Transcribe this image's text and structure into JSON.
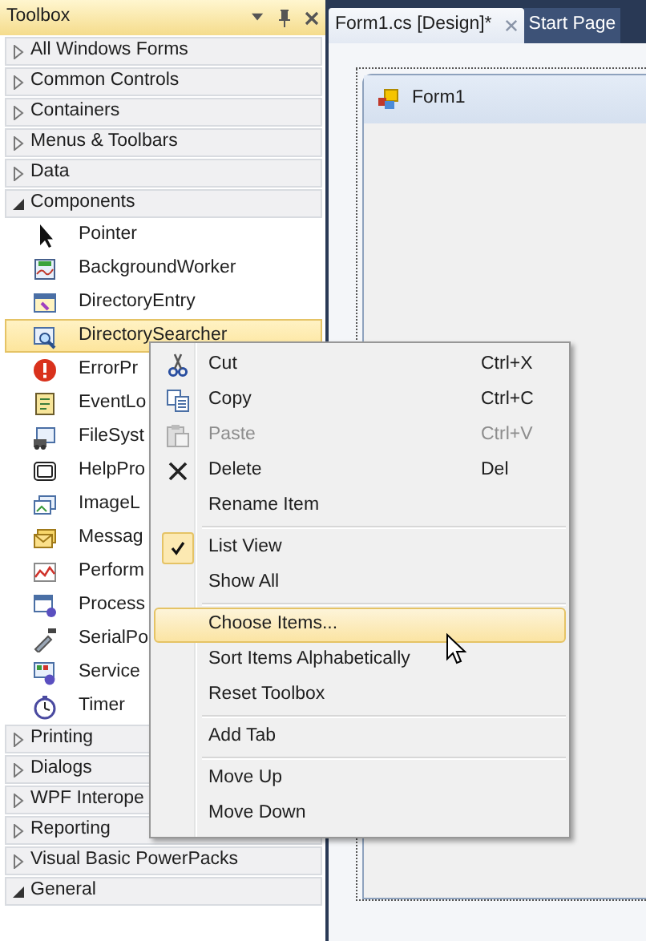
{
  "toolbox": {
    "title": "Toolbox",
    "categories": [
      {
        "label": "All Windows Forms",
        "expanded": false
      },
      {
        "label": "Common Controls",
        "expanded": false
      },
      {
        "label": "Containers",
        "expanded": false
      },
      {
        "label": "Menus & Toolbars",
        "expanded": false
      },
      {
        "label": "Data",
        "expanded": false
      },
      {
        "label": "Components",
        "expanded": true,
        "items": [
          {
            "label": "Pointer",
            "selected": false
          },
          {
            "label": "BackgroundWorker",
            "selected": false
          },
          {
            "label": "DirectoryEntry",
            "selected": false
          },
          {
            "label": "DirectorySearcher",
            "selected": true
          },
          {
            "label": "ErrorPr",
            "selected": false
          },
          {
            "label": "EventLo",
            "selected": false
          },
          {
            "label": "FileSyst",
            "selected": false
          },
          {
            "label": "HelpPro",
            "selected": false
          },
          {
            "label": "ImageL",
            "selected": false
          },
          {
            "label": "Messag",
            "selected": false
          },
          {
            "label": "Perform",
            "selected": false
          },
          {
            "label": "Process",
            "selected": false
          },
          {
            "label": "SerialPo",
            "selected": false
          },
          {
            "label": "Service",
            "selected": false
          },
          {
            "label": "Timer",
            "selected": false
          }
        ]
      },
      {
        "label": "Printing",
        "expanded": false
      },
      {
        "label": "Dialogs",
        "expanded": false
      },
      {
        "label": "WPF Interope",
        "expanded": false
      },
      {
        "label": "Reporting",
        "expanded": false
      },
      {
        "label": "Visual Basic PowerPacks",
        "expanded": false
      },
      {
        "label": "General",
        "expanded": true
      }
    ]
  },
  "tabs": [
    {
      "label": "Form1.cs [Design]*",
      "selected": true
    },
    {
      "label": "Start Page",
      "selected": false
    }
  ],
  "form": {
    "title": "Form1"
  },
  "context_menu": [
    {
      "kind": "item",
      "label": "Cut",
      "shortcut": "Ctrl+X",
      "disabled": false,
      "checked": false,
      "selected": false
    },
    {
      "kind": "item",
      "label": "Copy",
      "shortcut": "Ctrl+C",
      "disabled": false,
      "checked": false,
      "selected": false
    },
    {
      "kind": "item",
      "label": "Paste",
      "shortcut": "Ctrl+V",
      "disabled": true,
      "checked": false,
      "selected": false
    },
    {
      "kind": "item",
      "label": "Delete",
      "shortcut": "Del",
      "disabled": false,
      "checked": false,
      "selected": false
    },
    {
      "kind": "item",
      "label": "Rename Item",
      "disabled": false,
      "checked": false,
      "selected": false
    },
    {
      "kind": "separator"
    },
    {
      "kind": "item",
      "label": "List View",
      "disabled": false,
      "checked": true,
      "selected": false
    },
    {
      "kind": "item",
      "label": "Show All",
      "disabled": false,
      "checked": false,
      "selected": false
    },
    {
      "kind": "separator"
    },
    {
      "kind": "item",
      "label": "Choose Items...",
      "disabled": false,
      "checked": false,
      "selected": true
    },
    {
      "kind": "item",
      "label": "Sort Items Alphabetically",
      "disabled": false,
      "checked": false,
      "selected": false
    },
    {
      "kind": "item",
      "label": "Reset Toolbox",
      "disabled": false,
      "checked": false,
      "selected": false
    },
    {
      "kind": "separator"
    },
    {
      "kind": "item",
      "label": "Add Tab",
      "disabled": false,
      "checked": false,
      "selected": false
    },
    {
      "kind": "separator"
    },
    {
      "kind": "item",
      "label": "Move Up",
      "disabled": false,
      "checked": false,
      "selected": false
    },
    {
      "kind": "item",
      "label": "Move Down",
      "disabled": false,
      "checked": false,
      "selected": false
    }
  ]
}
